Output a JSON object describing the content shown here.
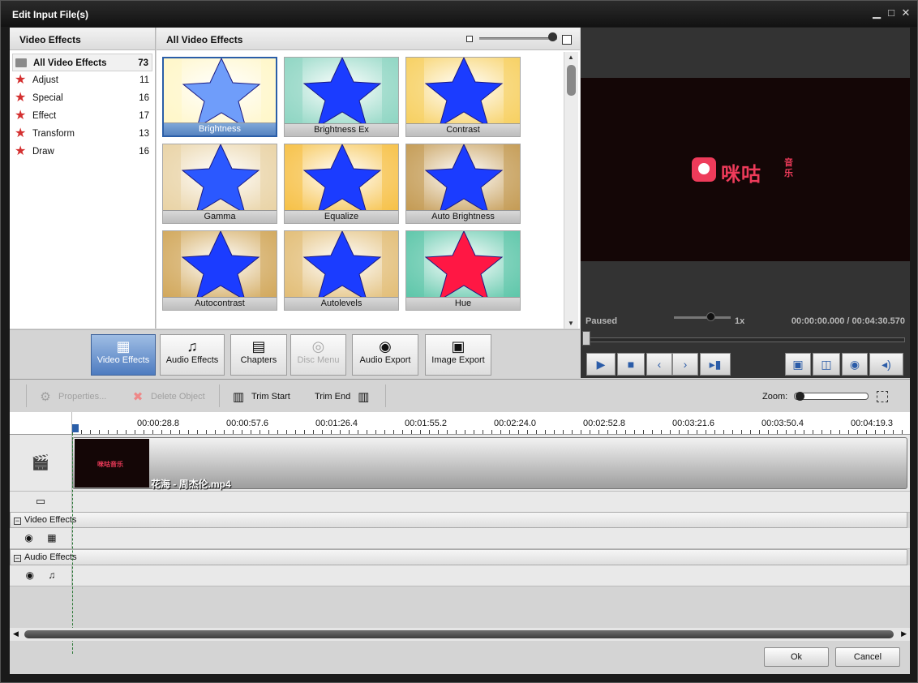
{
  "window": {
    "title": "Edit Input File(s)"
  },
  "categories": {
    "title": "Video Effects",
    "items": [
      {
        "label": "All Video Effects",
        "count": "73",
        "icon": "folder-icon",
        "selected": true
      },
      {
        "label": "Adjust",
        "count": "11",
        "icon": "star-icon"
      },
      {
        "label": "Special",
        "count": "16",
        "icon": "star-icon"
      },
      {
        "label": "Effect",
        "count": "17",
        "icon": "star-icon"
      },
      {
        "label": "Transform",
        "count": "13",
        "icon": "star-icon"
      },
      {
        "label": "Draw",
        "count": "16",
        "icon": "star-icon"
      }
    ]
  },
  "effects": {
    "title": "All Video Effects",
    "items": [
      {
        "label": "Brightness",
        "bg": "#fff6c8",
        "star": "#6f9dfa",
        "selected": true
      },
      {
        "label": "Brightness Ex",
        "bg": "#8fd6c3",
        "star": "#1b3cff"
      },
      {
        "label": "Contrast",
        "bg": "#f7d062",
        "star": "#1b3cff"
      },
      {
        "label": "Gamma",
        "bg": "#e9d3a6",
        "star": "#2b58ff"
      },
      {
        "label": "Equalize",
        "bg": "#f6c24a",
        "star": "#1b3cff"
      },
      {
        "label": "Auto Brightness",
        "bg": "#c59c56",
        "star": "#1b3cff"
      },
      {
        "label": "Autocontrast",
        "bg": "#d2a95d",
        "star": "#1b3cff"
      },
      {
        "label": "Autolevels",
        "bg": "#e2be78",
        "star": "#1b3cff"
      },
      {
        "label": "Hue",
        "bg": "#5fc7aa",
        "star": "#ff1744"
      }
    ]
  },
  "tabs": [
    {
      "label": "Video Effects",
      "icon": "film-effects-icon",
      "glyph": "▦",
      "active": true
    },
    {
      "label": "Audio Effects",
      "icon": "music-note-icon",
      "glyph": "♫"
    },
    {
      "label": "Chapters",
      "icon": "film-strip-icon",
      "glyph": "▤"
    },
    {
      "label": "Disc Menu",
      "icon": "disc-icon",
      "glyph": "◎",
      "disabled": true
    },
    {
      "label": "Audio Export",
      "icon": "speaker-icon",
      "glyph": "◉"
    },
    {
      "label": "Image Export",
      "icon": "image-icon",
      "glyph": "▣"
    }
  ],
  "preview": {
    "logo_text": "咪咕",
    "logo_sub": "音乐",
    "status": "Paused",
    "speed": "1x",
    "position": "00:00:00.000",
    "separator": "/",
    "duration": "00:04:30.570"
  },
  "toolbar": {
    "properties": "Properties...",
    "delete_object": "Delete Object",
    "trim_start": "Trim Start",
    "trim_end": "Trim End",
    "zoom": "Zoom:"
  },
  "ruler": {
    "labels": [
      "00:00:28.8",
      "00:00:57.6",
      "00:01:26.4",
      "00:01:55.2",
      "00:02:24.0",
      "00:02:52.8",
      "00:03:21.6",
      "00:03:50.4",
      "00:04:19.3"
    ]
  },
  "timeline": {
    "clip_name": "花海 - 周杰伦.mp4",
    "clip_mini": "咪咕音乐",
    "video_effects_group": "Video Effects",
    "audio_effects_group": "Audio Effects",
    "collapse_glyph": "−"
  },
  "buttons": {
    "ok": "Ok",
    "cancel": "Cancel"
  }
}
